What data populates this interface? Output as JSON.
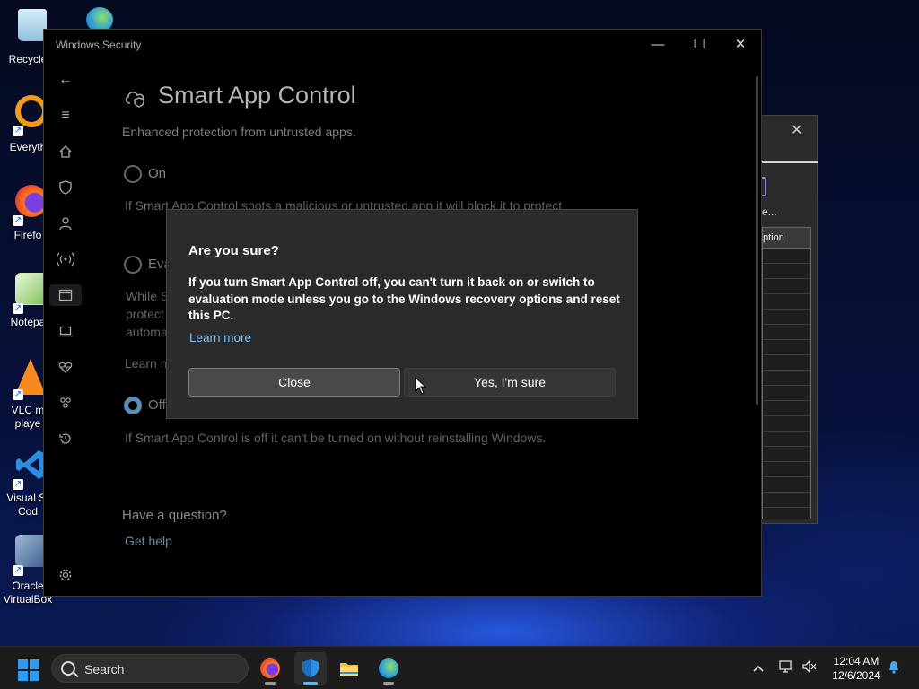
{
  "desktop": {
    "icons": [
      {
        "label": "Recycle",
        "icon": "recycle-bin-icon"
      },
      {
        "label": "Everyth",
        "icon": "everything-search-icon"
      },
      {
        "label": "Firefo",
        "icon": "firefox-icon"
      },
      {
        "label": "Notepa",
        "icon": "notepad-icon"
      },
      {
        "label": "VLC m\nplaye",
        "icon": "vlc-icon"
      },
      {
        "label": "Visual St\nCod",
        "icon": "vscode-icon"
      },
      {
        "label": "Oracle\nVirtualBox",
        "icon": "virtualbox-icon"
      }
    ]
  },
  "background_window": {
    "text": "e...",
    "column_header": "ption"
  },
  "window": {
    "title": "Windows Security",
    "controls": {
      "minimize": "—",
      "maximize": "☐",
      "close": "✕"
    }
  },
  "page": {
    "title": "Smart App Control",
    "subtitle": "Enhanced protection from untrusted apps.",
    "options": [
      {
        "label": "On",
        "description": "If Smart App Control spots a malicious or untrusted app it will block it to protect",
        "checked": false
      },
      {
        "label": "Eva",
        "description": "While S\nprotect\nautoma",
        "link": "Learn m",
        "checked": false
      },
      {
        "label": "Off",
        "description": "If Smart App Control is off it can't be turned on without reinstalling Windows.",
        "checked": true
      }
    ],
    "question": "Have a question?",
    "help_link": "Get help"
  },
  "dialog": {
    "title": "Are you sure?",
    "body": "If you turn Smart App Control off, you can't turn it back on or switch to evaluation mode unless you go to the Windows recovery options and reset this PC.",
    "link": "Learn more",
    "close_label": "Close",
    "confirm_label": "Yes, I'm sure"
  },
  "taskbar": {
    "search_label": "Search",
    "apps": [
      "firefox-icon",
      "windows-security-icon",
      "file-explorer-icon",
      "network-app-icon"
    ],
    "time": "12:04 AM",
    "date": "12/6/2024"
  },
  "colors": {
    "accent": "#5c8fb3",
    "link": "#7cc3f5",
    "start_blue": "#2e9bf0"
  }
}
